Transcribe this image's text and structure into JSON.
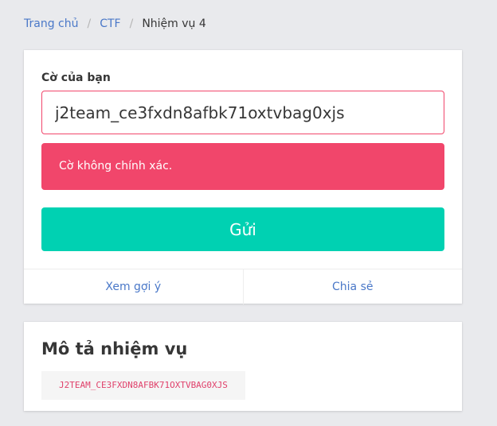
{
  "breadcrumb": {
    "home": "Trang chủ",
    "ctf": "CTF",
    "current": "Nhiệm vụ 4",
    "separator": "/"
  },
  "flag_form": {
    "label": "Cờ của bạn",
    "input_value": "j2team_ce3fxdn8afbk71oxtvbag0xjs",
    "error_message": "Cờ không chính xác.",
    "submit_label": "Gửi",
    "hint_label": "Xem gợi ý",
    "share_label": "Chia sẻ"
  },
  "description": {
    "title": "Mô tả nhiệm vụ",
    "code": "J2TEAM_CE3FXDN8AFBK71OXTVBAG0XJS"
  },
  "colors": {
    "link": "#4a78c8",
    "danger": "#f1466b",
    "primary": "#00d1b2",
    "code_text": "#e0416b"
  }
}
